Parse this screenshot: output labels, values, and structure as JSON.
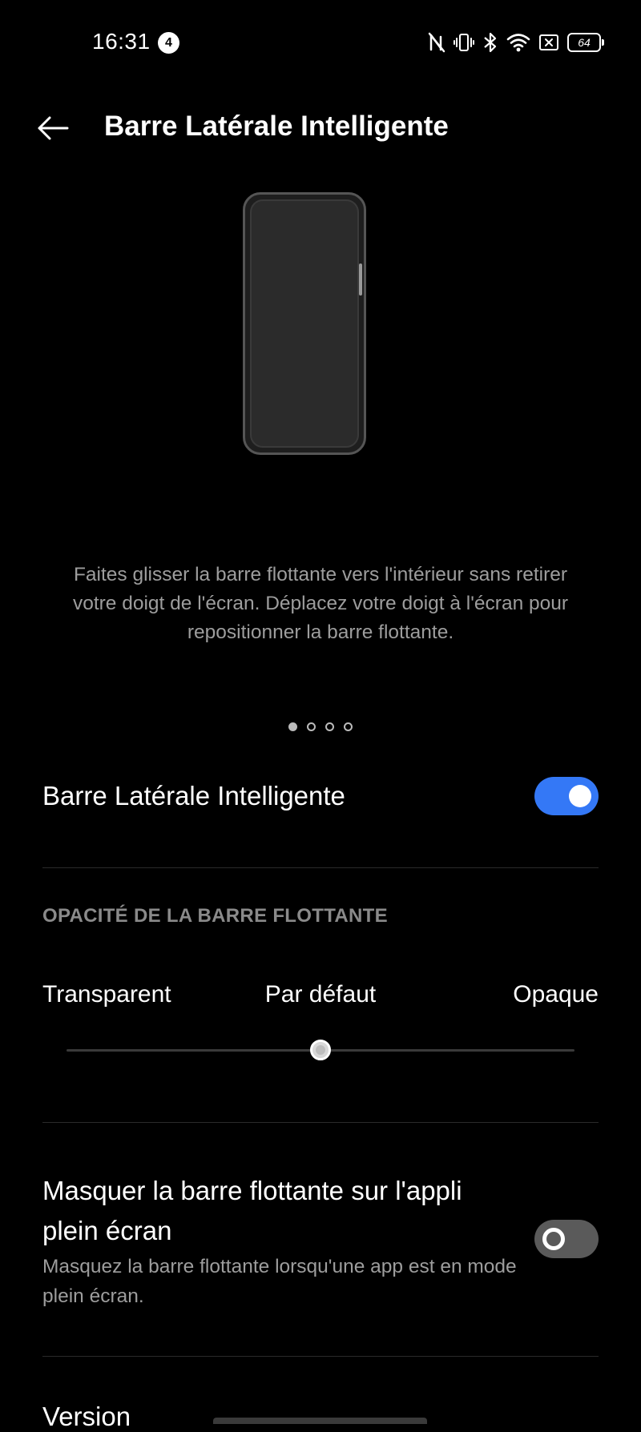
{
  "status_bar": {
    "time": "16:31",
    "notification_count": "4",
    "battery_level": "64",
    "icons": [
      "nfc-off-icon",
      "vibrate-icon",
      "bluetooth-icon",
      "wifi-icon",
      "sim-off-icon",
      "battery-icon"
    ]
  },
  "header": {
    "back_icon": "arrow-left-icon",
    "title": "Barre Latérale Intelligente"
  },
  "illustration": {
    "description": "Faites glisser la barre flottante vers l'intérieur sans retirer votre doigt de l'écran. Déplacez votre doigt à l'écran pour repositionner la barre flottante.",
    "page_count": 4,
    "active_page": 1
  },
  "smart_sidebar": {
    "label": "Barre Latérale Intelligente",
    "enabled": true,
    "accent_color": "#3478f6"
  },
  "opacity": {
    "section_header": "OPACITÉ DE LA BARRE FLOTTANTE",
    "left_label": "Transparent",
    "center_label": "Par défaut",
    "right_label": "Opaque",
    "value_fraction": 0.5
  },
  "hide_fullscreen": {
    "title": "Masquer la barre flottante sur l'appli plein écran",
    "description": "Masquez la barre flottante lorsqu'une app est en mode plein écran.",
    "enabled": false
  },
  "version": {
    "label": "Version"
  }
}
